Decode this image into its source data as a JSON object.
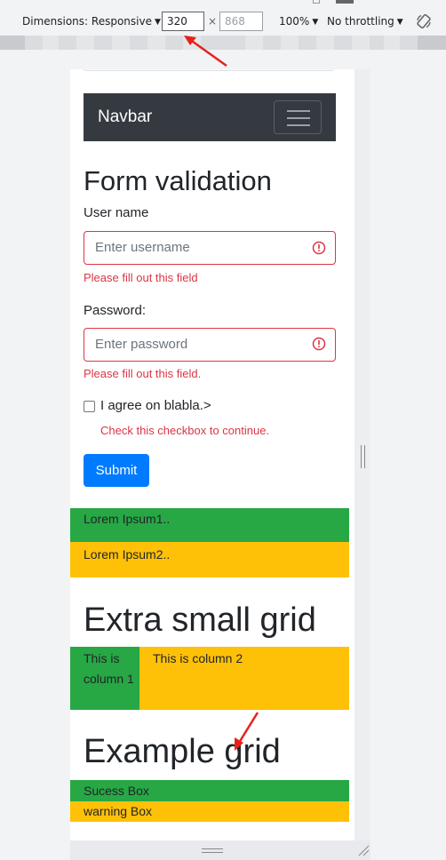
{
  "devtools": {
    "dimensions_label": "Dimensions: Responsive",
    "width_value": "320",
    "times_symbol": "×",
    "height_placeholder": "868",
    "zoom_label": "100%",
    "throttling_label": "No throttling"
  },
  "page": {
    "navbar": {
      "brand": "Navbar"
    },
    "form": {
      "title": "Form validation",
      "username_label": "User name",
      "username_placeholder": "Enter username",
      "username_error": "Please fill out this field",
      "password_label": "Password:",
      "password_placeholder": "Enter password",
      "password_error": "Please fill out this field.",
      "checkbox_label": "I agree on blabla.>",
      "checkbox_error": "Check this checkbox to continue.",
      "submit_label": "Submit"
    },
    "lorem": {
      "box1": "Lorem Ipsum1..",
      "box2": "Lorem Ipsum2.."
    },
    "extra_small_grid": {
      "title": "Extra small grid",
      "col1": "This is column 1",
      "col2": "This is column 2"
    },
    "example_grid": {
      "title": "Example grid",
      "success": "Sucess Box",
      "warning": "warning Box"
    }
  },
  "colors": {
    "success": "#28a745",
    "warning": "#ffc107",
    "danger": "#dc3545",
    "primary": "#007bff",
    "navbar_dark": "#343a40",
    "annotation_arrow": "#e8201c"
  }
}
